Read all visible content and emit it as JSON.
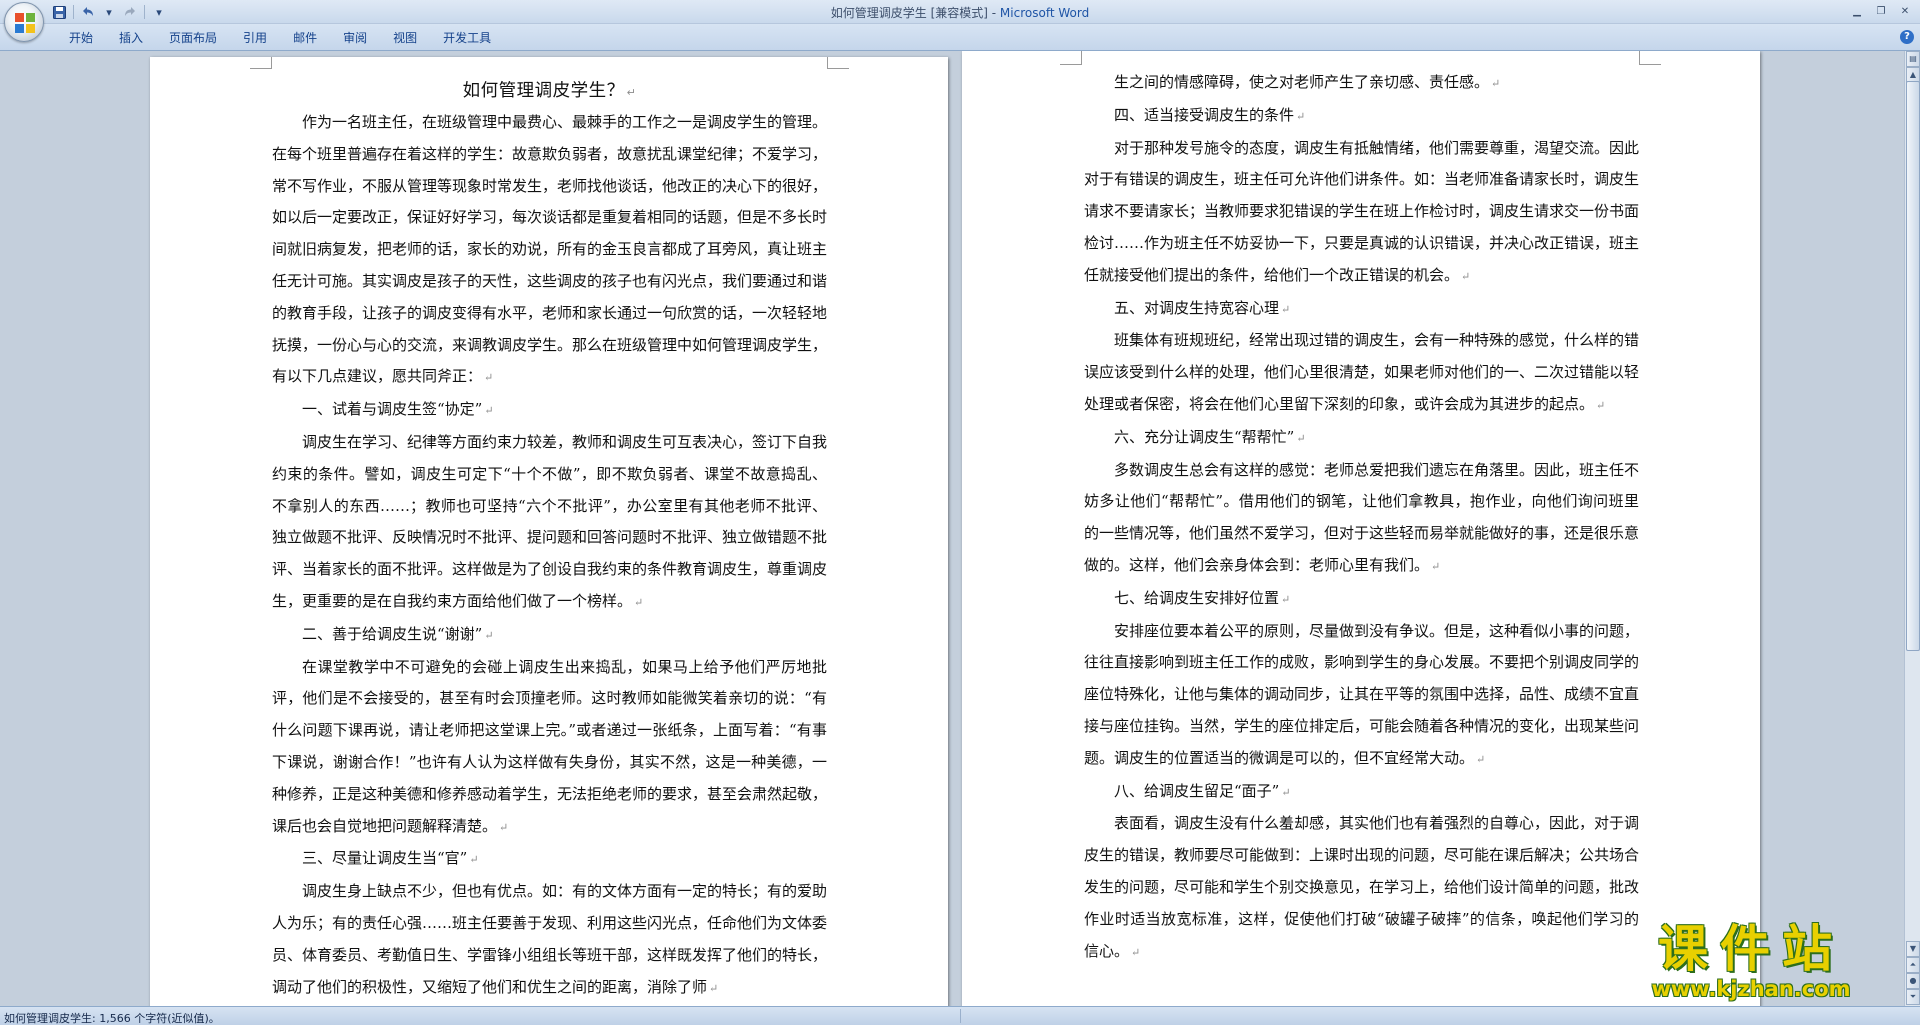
{
  "window": {
    "title": "如何管理调皮学生 [兼容模式] - ",
    "app_name": "Microsoft Word"
  },
  "qat": {
    "save_icon": "save-icon",
    "undo_icon": "undo-icon",
    "redo_icon": "redo-icon",
    "customize_icon": "chevron-down-icon"
  },
  "ribbon": {
    "tabs": [
      {
        "label": "开始"
      },
      {
        "label": "插入"
      },
      {
        "label": "页面布局"
      },
      {
        "label": "引用"
      },
      {
        "label": "邮件"
      },
      {
        "label": "审阅"
      },
      {
        "label": "视图"
      },
      {
        "label": "开发工具"
      }
    ],
    "help": "?"
  },
  "document": {
    "title": "如何管理调皮学生？",
    "paragraph_mark": "↵",
    "left_paragraphs": [
      "作为一名班主任，在班级管理中最费心、最棘手的工作之一是调皮学生的管理。在每个班里普遍存在着这样的学生：故意欺负弱者，故意扰乱课堂纪律；不爱学习，常不写作业，不服从管理等现象时常发生，老师找他谈话，他改正的决心下的很好，如以后一定要改正，保证好好学习，每次谈话都是重复着相同的话题，但是不多长时间就旧病复发，把老师的话，家长的劝说，所有的金玉良言都成了耳旁风，真让班主任无计可施。其实调皮是孩子的天性，这些调皮的孩子也有闪光点，我们要通过和谐的教育手段，让孩子的调皮变得有水平，老师和家长通过一句欣赏的话，一次轻轻地抚摸，一份心与心的交流，来调教调皮学生。那么在班级管理中如何管理调皮学生，有以下几点建议，愿共同斧正：",
      "一、试着与调皮生签“协定”",
      "调皮生在学习、纪律等方面约束力较差，教师和调皮生可互表决心，签订下自我约束的条件。譬如，调皮生可定下“十个不做”，即不欺负弱者、课堂不故意捣乱、不拿别人的东西……；教师也可坚持“六个不批评”，办公室里有其他老师不批评、独立做题不批评、反映情况时不批评、提问题和回答问题时不批评、独立做错题不批评、当着家长的面不批评。这样做是为了创设自我约束的条件教育调皮生，尊重调皮生，更重要的是在自我约束方面给他们做了一个榜样。",
      "二、善于给调皮生说“谢谢”",
      "在课堂教学中不可避免的会碰上调皮生出来捣乱，如果马上给予他们严厉地批评，他们是不会接受的，甚至有时会顶撞老师。这时教师如能微笑着亲切的说：“有什么问题下课再说，请让老师把这堂课上完。”或者递过一张纸条，上面写着：“有事下课说，谢谢合作！”也许有人认为这样做有失身份，其实不然，这是一种美德，一种修养，正是这种美德和修养感动着学生，无法拒绝老师的要求，甚至会肃然起敬，课后也会自觉地把问题解释清楚。",
      "三、尽量让调皮生当“官”",
      "调皮生身上缺点不少，但也有优点。如：有的文体方面有一定的特长；有的爱助人为乐；有的责任心强……班主任要善于发现、利用这些闪光点，任命他们为文体委员、体育委员、考勤值日生、学雷锋小组组长等班干部，这样既发挥了他们的特长，调动了他们的积极性，又缩短了他们和优生之间的距离，消除了师"
    ],
    "right_paragraphs": [
      "生之间的情感障碍，使之对老师产生了亲切感、责任感。",
      "四、适当接受调皮生的条件",
      "对于那种发号施令的态度，调皮生有抵触情绪，他们需要尊重，渴望交流。因此对于有错误的调皮生，班主任可允许他们讲条件。如：当老师准备请家长时，调皮生请求不要请家长；当教师要求犯错误的学生在班上作检讨时，调皮生请求交一份书面检讨……作为班主任不妨妥协一下，只要是真诚的认识错误，并决心改正错误，班主任就接受他们提出的条件，给他们一个改正错误的机会。",
      "五、对调皮生持宽容心理",
      "班集体有班规班纪，经常出现过错的调皮生，会有一种特殊的感觉，什么样的错误应该受到什么样的处理，他们心里很清楚，如果老师对他们的一、二次过错能以轻处理或者保密，将会在他们心里留下深刻的印象，或许会成为其进步的起点。",
      "六、充分让调皮生“帮帮忙”",
      "多数调皮生总会有这样的感觉：老师总爱把我们遗忘在角落里。因此，班主任不妨多让他们“帮帮忙”。借用他们的钢笔，让他们拿教具，抱作业，向他们询问班里的一些情况等，他们虽然不爱学习，但对于这些轻而易举就能做好的事，还是很乐意做的。这样，他们会亲身体会到：老师心里有我们。",
      "七、给调皮生安排好位置",
      "安排座位要本着公平的原则，尽量做到没有争议。但是，这种看似小事的问题，往往直接影响到班主任工作的成败，影响到学生的身心发展。不要把个别调皮同学的座位特殊化，让他与集体的调动同步，让其在平等的氛围中选择，品性、成绩不宜直接与座位挂钩。当然，学生的座位排定后，可能会随着各种情况的变化，出现某些问题。调皮生的位置适当的微调是可以的，但不宜经常大动。",
      "八、给调皮生留足“面子”",
      "表面看，调皮生没有什么羞却感，其实他们也有着强烈的自尊心，因此，对于调皮生的错误，教师要尽可能做到：上课时出现的问题，尽可能在课后解决；公共场合发生的问题，尽可能和学生个别交换意见，在学习上，给他们设计简单的问题，批改作业时适当放宽标准，这样，促使他们打破“破罐子破摔”的信条，唤起他们学习的信心。"
    ]
  },
  "statusbar": {
    "text": "如何管理调皮学生: 1,566 个字符(近似值)。"
  },
  "watermark": {
    "name": "课件站",
    "url": "www.kjzhan.com"
  }
}
